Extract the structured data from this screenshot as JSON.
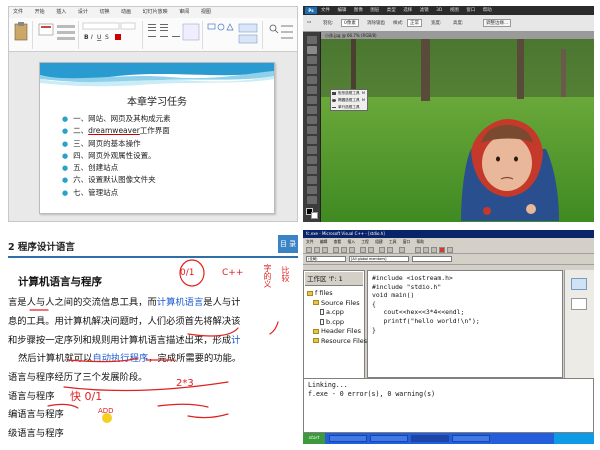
{
  "powerpoint": {
    "menu": [
      "文件",
      "开始",
      "插入",
      "设计",
      "切换",
      "动画",
      "幻灯片放映",
      "审阅",
      "视图"
    ],
    "slide_title": "本章学习任务",
    "bullets": [
      {
        "text": "一、网站、网页及其构成元素"
      },
      {
        "prefix": "二、",
        "underlined": "dreamweaver",
        "suffix": "工作界面"
      },
      {
        "text": "三、网页的基本操作"
      },
      {
        "text": "四、网页外观属性设置。"
      },
      {
        "text": "五、创建站点"
      },
      {
        "text": "六、设置默认图像文件夹"
      },
      {
        "text": "七、管理站点"
      }
    ]
  },
  "photoshop": {
    "logo": "Ps",
    "menu": [
      "文件",
      "编辑",
      "图像",
      "图层",
      "类型",
      "选择",
      "滤镜",
      "3D",
      "视图",
      "窗口",
      "帮助"
    ],
    "options": [
      "羽化:",
      "0像素",
      "消除锯齿",
      "样式:",
      "正常",
      "宽度:",
      "高度:",
      "调整边缘..."
    ],
    "doc_tab": "小孩.jpg @ 66.7% (RGB/8)",
    "flyout": [
      {
        "label": "矩形选框工具",
        "key": "M"
      },
      {
        "label": "椭圆选框工具",
        "key": "M"
      },
      {
        "label": "单行选框工具",
        "key": ""
      }
    ]
  },
  "textbook": {
    "header_title": "2 程序设计语言",
    "header_tag": "目 录",
    "section_title": "计算机语言与程序",
    "para1": {
      "a": "言是人与人之间的交流信息工具，而",
      "b": "计算机语言",
      "c": "是人与计"
    },
    "para2": "息的工具。用计算机解决问题时，人们必须首先将解决该",
    "para3a": "和步骤按一定序列和规则用计算机语言描述出来，形成",
    "para3b": "计",
    "para4a": "然后计算机就可以",
    "para4b": "自动执行程序",
    "para4c": "，完成所需要的功能。",
    "para5": "语言与程序经历了三个发展阶段。",
    "items": [
      "语言与程序",
      "编语言与程序",
      "级语言与程序"
    ],
    "ink": {
      "binary": "0/1",
      "cpp": "C++",
      "side1": "字的义",
      "side2": "比较",
      "quick": "快 0/1",
      "mul": "2*3",
      "asm": "ADD"
    }
  },
  "vcpp": {
    "title": "fc.exe - Microsoft Visual C++ - [stdio.h]",
    "menu": [
      "文件",
      "编辑",
      "查看",
      "插入",
      "工程",
      "组建",
      "工具",
      "窗口",
      "帮助"
    ],
    "combo1": "(全局)",
    "combo2": "[All global members]",
    "workspace_title": "工作区 'f': 1",
    "tree": [
      "f files",
      "Source Files",
      "a.cpp",
      "b.cpp",
      "Header Files",
      "Resource Files"
    ],
    "code": [
      "#include <iostream.h>",
      "#include \"stdio.h\"",
      "void main()",
      "{",
      "   cout<<hex<<3*4<<endl;",
      "   printf(\"hello world!\\n\");",
      "}"
    ],
    "output": [
      "Linking...",
      "",
      "f.exe - 0 error(s), 0 warning(s)"
    ]
  }
}
